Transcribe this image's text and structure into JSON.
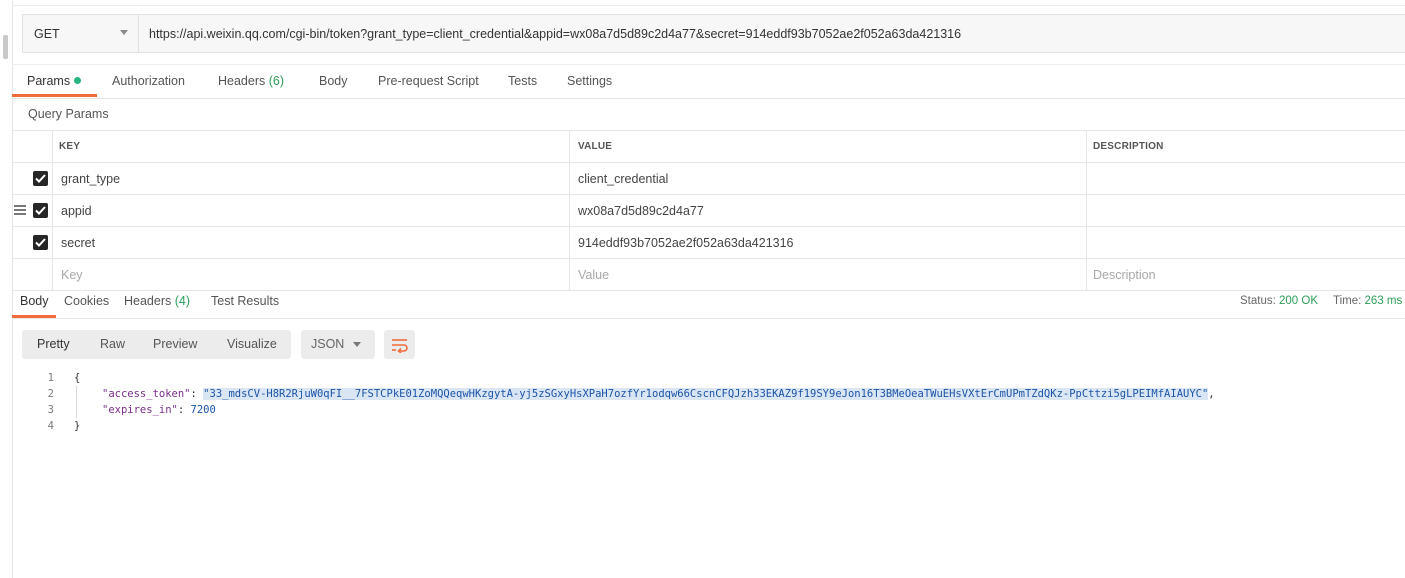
{
  "request": {
    "method": "GET",
    "url": "https://api.weixin.qq.com/cgi-bin/token?grant_type=client_credential&appid=wx08a7d5d89c2d4a77&secret=914eddf93b7052ae2f052a63da421316"
  },
  "tabs": [
    {
      "label": "Params"
    },
    {
      "label": "Authorization"
    },
    {
      "label": "Headers",
      "count": "(6)"
    },
    {
      "label": "Body"
    },
    {
      "label": "Pre-request Script"
    },
    {
      "label": "Tests"
    },
    {
      "label": "Settings"
    }
  ],
  "query_params": {
    "title": "Query Params",
    "columns": [
      "KEY",
      "VALUE",
      "DESCRIPTION"
    ],
    "rows": [
      {
        "key": "grant_type",
        "value": "client_credential",
        "checked": true
      },
      {
        "key": "appid",
        "value": "wx08a7d5d89c2d4a77",
        "checked": true
      },
      {
        "key": "secret",
        "value": "914eddf93b7052ae2f052a63da421316",
        "checked": true
      }
    ],
    "placeholders": {
      "key": "Key",
      "value": "Value",
      "description": "Description"
    }
  },
  "response": {
    "tabs": [
      {
        "label": "Body"
      },
      {
        "label": "Cookies"
      },
      {
        "label": "Headers",
        "count": "(4)"
      },
      {
        "label": "Test Results"
      }
    ],
    "status_label": "Status:",
    "status_value": "200 OK",
    "time_label": "Time:",
    "time_value": "263 ms",
    "view_modes": [
      "Pretty",
      "Raw",
      "Preview",
      "Visualize"
    ],
    "format": "JSON",
    "body_lines": [
      {
        "num": "1",
        "open": "{"
      },
      {
        "num": "2",
        "key": "\"access_token\"",
        "sep": ": ",
        "value": "\"33_mdsCV-H8R2RjuW0qFI__7FSTCPkE01ZoMQQeqwHKzgytA-yj5zSGxyHsXPaH7ozfYr1odqw66CscnCFQJzh33EKAZ9f19SY9eJon16T3BMeOeaTWuEHsVXtErCmUPmTZdQKz-PpCttzi5gLPEIMfAIAUYC\"",
        "end": ","
      },
      {
        "num": "3",
        "key": "\"expires_in\"",
        "sep": ": ",
        "value": "7200"
      },
      {
        "num": "4",
        "close": "}"
      }
    ]
  },
  "colors": {
    "accent": "#f26b3a",
    "success": "#2e9e57",
    "dot": "#26b47f"
  }
}
